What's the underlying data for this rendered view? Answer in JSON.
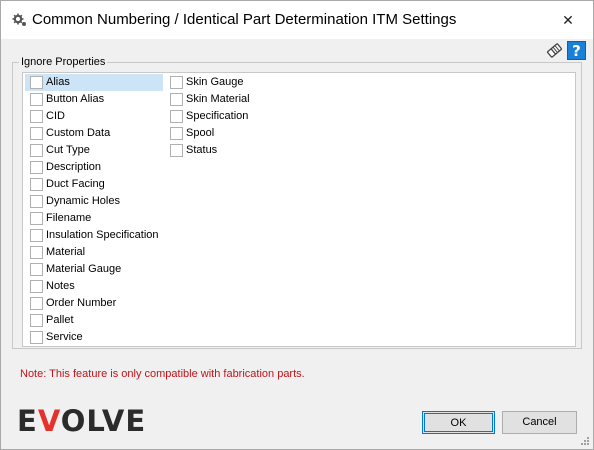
{
  "window": {
    "title": "Common Numbering / Identical Part Determination ITM Settings",
    "close_glyph": "✕"
  },
  "toolbar": {
    "clear_icon": "eraser-icon",
    "help_label": "?"
  },
  "group": {
    "legend": "Ignore Properties",
    "items_col1": [
      {
        "label": "Alias",
        "checked": false,
        "selected": true
      },
      {
        "label": "Button Alias",
        "checked": false
      },
      {
        "label": "CID",
        "checked": false
      },
      {
        "label": "Custom Data",
        "checked": false
      },
      {
        "label": "Cut Type",
        "checked": false
      },
      {
        "label": "Description",
        "checked": false
      },
      {
        "label": "Duct Facing",
        "checked": false
      },
      {
        "label": "Dynamic Holes",
        "checked": false
      },
      {
        "label": "Filename",
        "checked": false
      },
      {
        "label": "Insulation Specification",
        "checked": false
      },
      {
        "label": "Material",
        "checked": false
      },
      {
        "label": "Material Gauge",
        "checked": false
      },
      {
        "label": "Notes",
        "checked": false
      },
      {
        "label": "Order Number",
        "checked": false
      },
      {
        "label": "Pallet",
        "checked": false
      },
      {
        "label": "Service",
        "checked": false
      }
    ],
    "items_col2": [
      {
        "label": "Skin Gauge",
        "checked": false
      },
      {
        "label": "Skin Material",
        "checked": false
      },
      {
        "label": "Specification",
        "checked": false
      },
      {
        "label": "Spool",
        "checked": false
      },
      {
        "label": "Status",
        "checked": false
      }
    ]
  },
  "note": "Note: This feature is only compatible with fabrication parts.",
  "logo": {
    "prefix": "E",
    "o": "V",
    "suffix": "OLVE",
    "full": "EVOLVE",
    "brand_color": "#e4312b"
  },
  "buttons": {
    "ok": "OK",
    "cancel": "Cancel"
  }
}
